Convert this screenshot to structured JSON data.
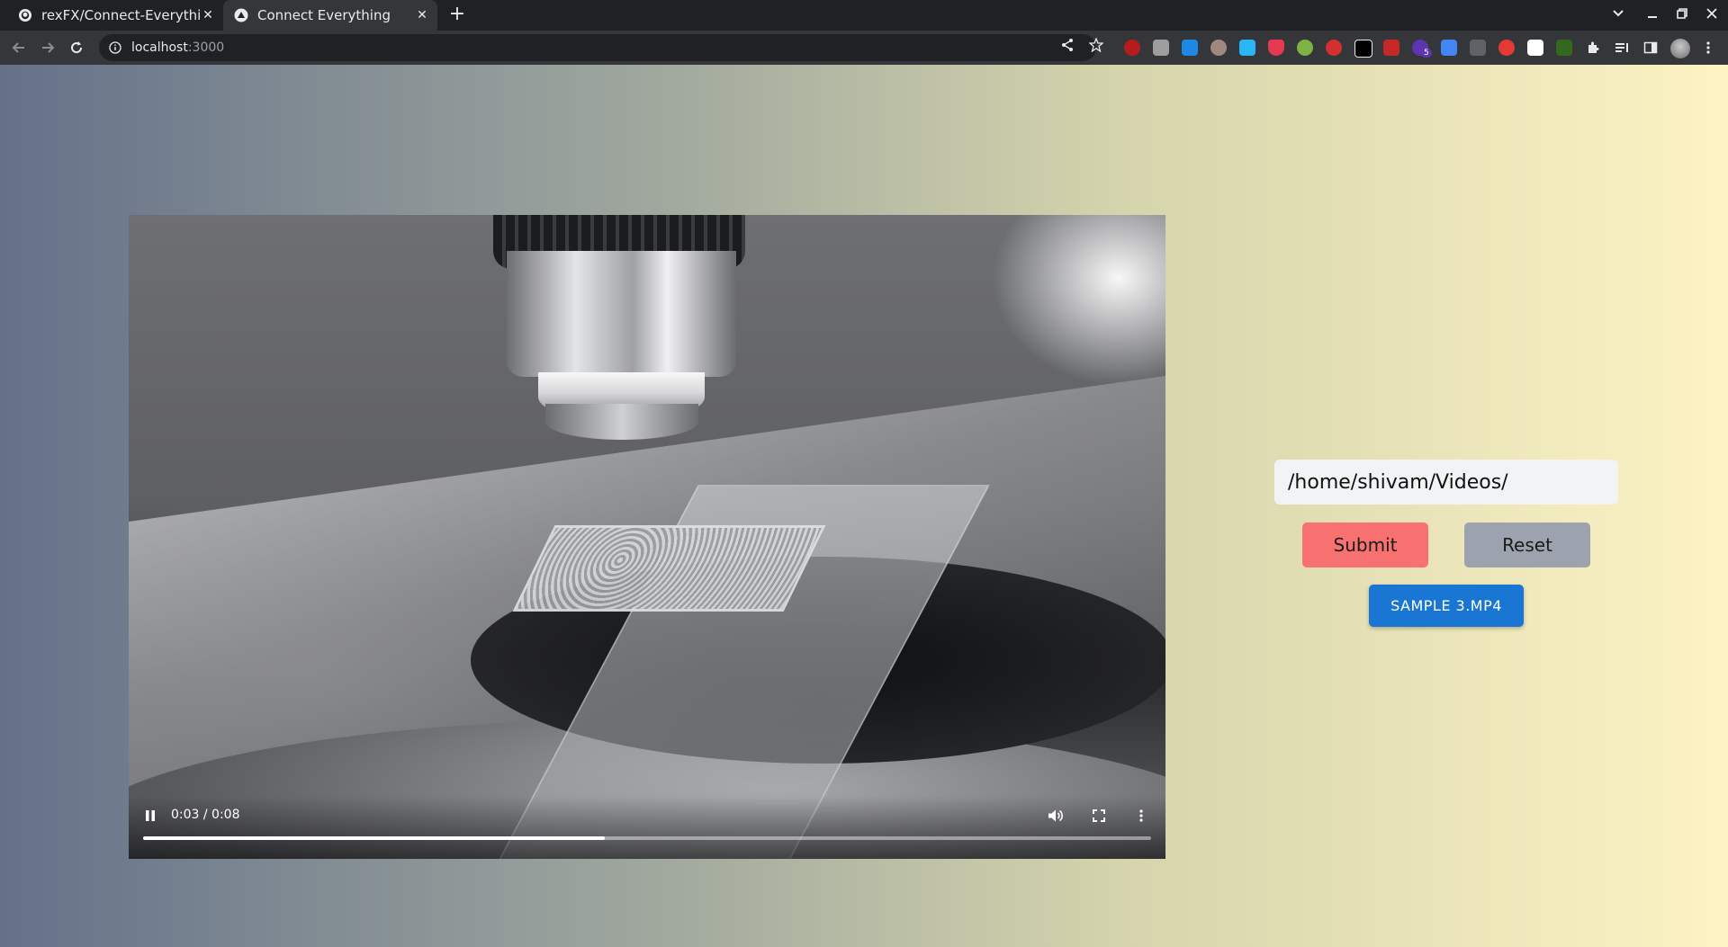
{
  "browser": {
    "tabs": [
      {
        "title": "rexFX/Connect-Everything",
        "icon": "github-icon",
        "active": false
      },
      {
        "title": "Connect Everything",
        "icon": "triangle-logo-icon",
        "active": true
      }
    ],
    "url_host": "localhost",
    "url_port": ":3000",
    "extension_badge": "5"
  },
  "video": {
    "current_time": "0:03",
    "duration": "0:08",
    "time_display": "0:03 / 0:08",
    "progress_fraction": 0.458,
    "state": "playing"
  },
  "form": {
    "path_value": "/home/shivam/Videos/",
    "submit_label": "Submit",
    "reset_label": "Reset"
  },
  "file_button": {
    "label": "SAMPLE 3.MP4"
  },
  "colors": {
    "submit": "#f87171",
    "reset": "#9ca3af",
    "file_button": "#1976d2",
    "gradient_start": "#647189",
    "gradient_end": "#fdf3c4"
  }
}
